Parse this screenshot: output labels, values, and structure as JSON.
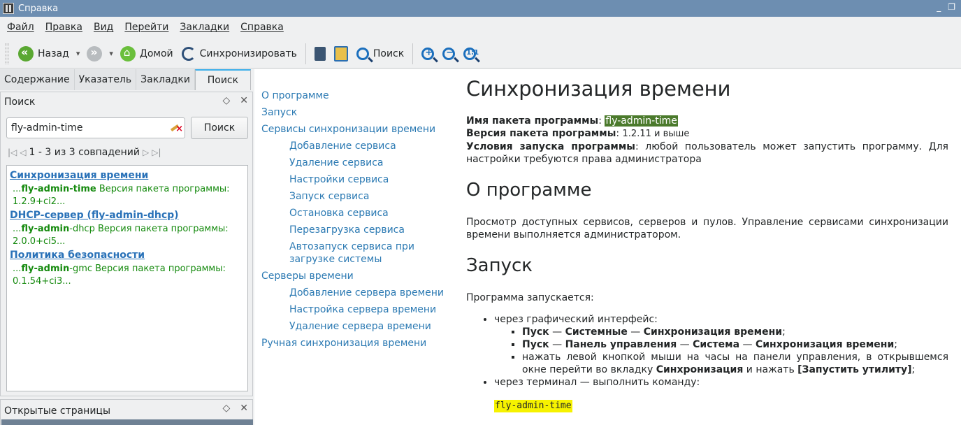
{
  "window": {
    "title": "Справка"
  },
  "menu": [
    "Файл",
    "Правка",
    "Вид",
    "Перейти",
    "Закладки",
    "Справка"
  ],
  "toolbar": {
    "back": "Назад",
    "home": "Домой",
    "sync": "Синхронизировать",
    "search": "Поиск"
  },
  "tabs": [
    "Содержание",
    "Указатель",
    "Закладки",
    "Поиск"
  ],
  "search_dock": {
    "title": "Поиск",
    "query": "fly-admin-time",
    "button": "Поиск",
    "pager_text": "1 - 3 из 3 совпадений",
    "results": [
      {
        "title": "Синхронизация времени",
        "snippet_pre": "...",
        "snippet_bold": "fly-admin-time",
        "snippet_rest": " Версия пакета программы: 1.2.9+ci2..."
      },
      {
        "title": "DHCP-сервер (fly-admin-dhcp)",
        "snippet_pre": "...",
        "snippet_bold": "fly-admin",
        "snippet_rest": "-dhcp Версия пакета программы: 2.0.0+ci5..."
      },
      {
        "title": "Политика безопасности",
        "snippet_pre": "...",
        "snippet_bold": "fly-admin",
        "snippet_rest": "-gmc Версия пакета программы: 0.1.54+ci3..."
      }
    ]
  },
  "opened_dock": {
    "title": "Открытые страницы"
  },
  "toc": {
    "about": "О программе",
    "launch": "Запуск",
    "services": "Сервисы синхронизации времени",
    "service_items": [
      "Добавление сервиса",
      "Удаление сервиса",
      "Настройки сервиса",
      "Запуск сервиса",
      "Остановка сервиса",
      "Перезагрузка сервиса",
      "Автозапуск сервиса при загрузке системы"
    ],
    "servers": "Серверы времени",
    "server_items": [
      "Добавление сервера времени",
      "Настройка сервера времени",
      "Удаление сервера времени"
    ],
    "manual": "Ручная синхронизация времени"
  },
  "article": {
    "title": "Синхронизация времени",
    "pkg_label": "Имя пакета программы",
    "pkg_value": "fly-admin-time",
    "ver_label": "Версия пакета программы",
    "ver_value": "1.2.11 и выше",
    "cond_label": "Условия запуска программы",
    "cond_value": "любой пользователь может запустить программу. Для настройки требуются права администратора",
    "about_h": "О программе",
    "about_p": "Просмотр доступных сервисов, серверов и пулов. Управление сервисами синхронизации времени выполняется администратором.",
    "launch_h": "Запуск",
    "launch_p": "Программа запускается:",
    "gui": "через графический интерфейс:",
    "path1": [
      "Пуск",
      "Системные",
      "Синхронизация времени"
    ],
    "path2": [
      "Пуск",
      "Панель управления",
      "Система",
      "Синхронизация времени"
    ],
    "item3_pre": "нажать левой кнопкой мыши на часы на панели управления, в открывшемся окне перейти во вкладку ",
    "item3_tab": "Синхронизация",
    "item3_mid": " и нажать ",
    "item3_btn": "[Запустить утилиту]",
    "terminal": "через терминал — выполнить команду:",
    "command": "fly-admin-time"
  }
}
